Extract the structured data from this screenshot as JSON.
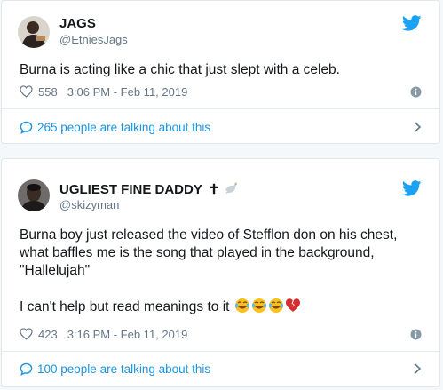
{
  "tweets": [
    {
      "name": "JAGS",
      "handle": "@EtniesJags",
      "text_lines": [
        "Burna is acting like a chic that just slept with a celeb."
      ],
      "likes": "558",
      "timestamp": "3:06 PM - Feb 11, 2019",
      "talking": "265 people are talking about this"
    },
    {
      "name": "UGLIEST FINE DADDY",
      "name_suffix": "✝",
      "handle": "@skizyman",
      "text_lines": [
        "Burna boy just released the video of Stefflon don on his chest,",
        "what baffles me is the song that played in the background,",
        "\"Hallelujah\""
      ],
      "text_line2": "I can't help but read meanings to it",
      "likes": "423",
      "timestamp": "3:16 PM - Feb 11, 2019",
      "talking": "100 people are talking about this"
    }
  ],
  "colors": {
    "accent": "#1da1f2",
    "link": "#1b95e0",
    "muted": "#657786",
    "text": "#14171a"
  },
  "icons": [
    "twitter-bird-icon",
    "heart-icon",
    "info-icon",
    "speech-bubble-icon",
    "chevron-right-icon",
    "laughing-tears-emoji",
    "broken-heart-emoji",
    "dove-emoji"
  ]
}
